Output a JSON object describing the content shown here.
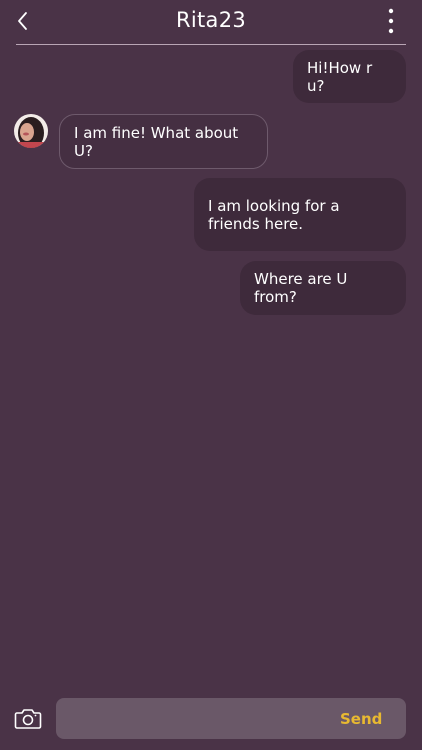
{
  "header": {
    "title": "Rita23",
    "back_icon": "chevron-left-icon",
    "more_icon": "more-vertical-icon"
  },
  "messages": [
    {
      "direction": "outgoing",
      "text": "Hi!How r u?"
    },
    {
      "direction": "incoming",
      "text": "I am fine! What about U?"
    },
    {
      "direction": "outgoing",
      "text": "I am looking for a friends here."
    },
    {
      "direction": "outgoing",
      "text": "Where are U from?"
    }
  ],
  "composer": {
    "camera_icon": "camera-icon",
    "input_value": "",
    "input_placeholder": "",
    "send_label": "Send"
  },
  "colors": {
    "background": "#4a3347",
    "bubble": "#3e2a3b",
    "input": "#6a5868",
    "accent": "#e8b931"
  }
}
